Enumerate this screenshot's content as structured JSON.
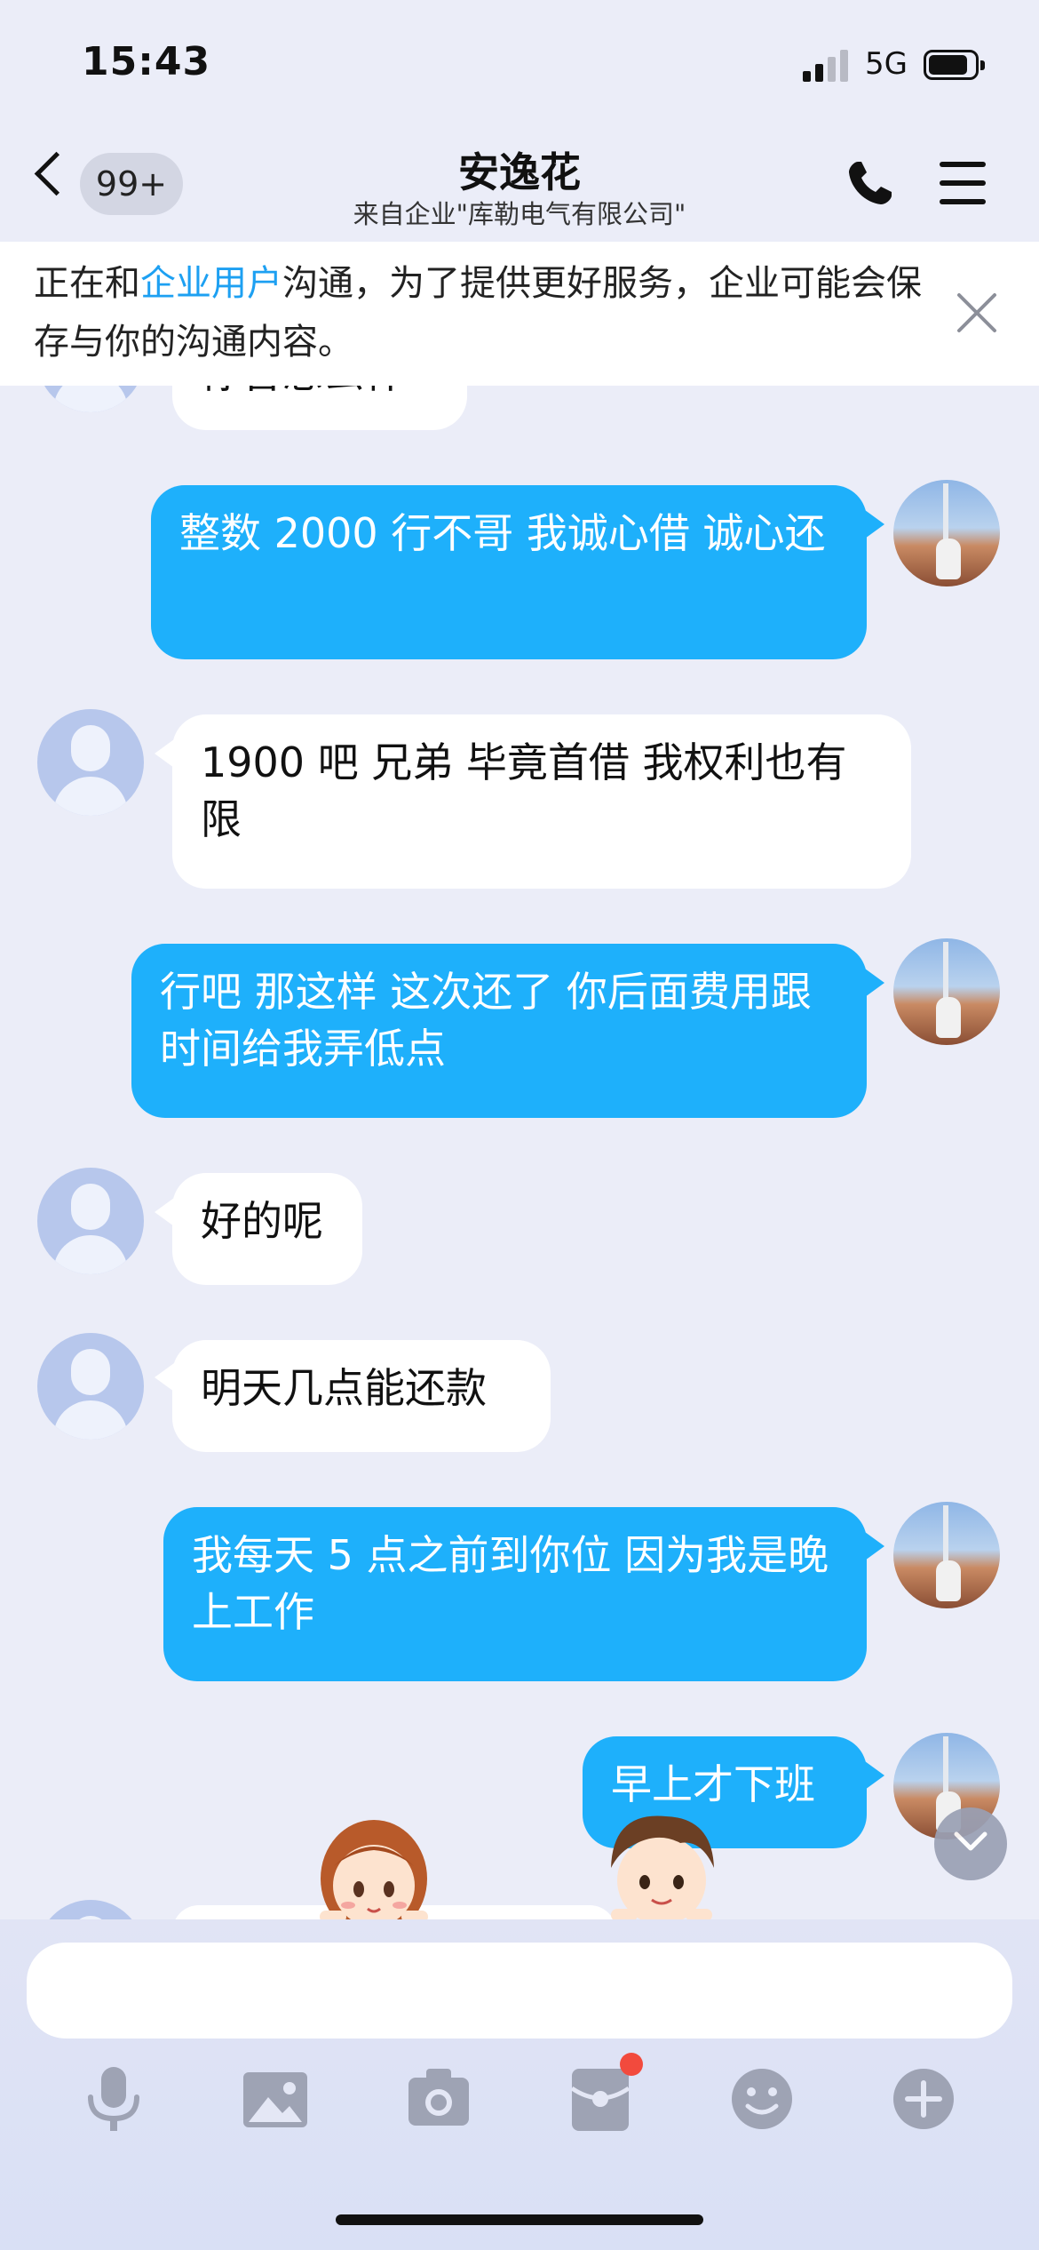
{
  "status_bar": {
    "time": "15:43",
    "network": "5G",
    "battery_level": 0.85
  },
  "header": {
    "unread_count": "99+",
    "title": "安逸花",
    "subtitle": "来自企业\"库勒电气有限公司\""
  },
  "notice": {
    "text_before": "正在和",
    "highlight": "企业用户",
    "text_after": "沟通，为了提供更好服务，企业可能会保存与你的沟通内容。"
  },
  "messages": [
    {
      "side": "in",
      "text": "你曾想么什"
    },
    {
      "side": "out",
      "text": "整数 2000 行不哥  我诚心借 诚心还"
    },
    {
      "side": "in",
      "text": "1900 吧   兄弟    毕竟首借   我权利也有限"
    },
    {
      "side": "out",
      "text": "行吧 那这样 这次还了 你后面费用跟时间给我弄低点"
    },
    {
      "side": "in",
      "text": "好的呢"
    },
    {
      "side": "in",
      "text": "明天几点能还款"
    },
    {
      "side": "out",
      "text": "我每天 5 点之前到你位 因为我是晚上工作"
    },
    {
      "side": "out",
      "text": "早上才下班"
    }
  ],
  "toolbar": {
    "icons": [
      "microphone-icon",
      "image-icon",
      "camera-icon",
      "red-packet-icon",
      "emoji-icon",
      "plus-icon"
    ],
    "has_notification_dot": true
  },
  "colors": {
    "outgoing_bubble": "#1eb0fb",
    "incoming_bubble": "#ffffff",
    "accent_link": "#1da0f2",
    "chat_background": "#ebedf8"
  }
}
